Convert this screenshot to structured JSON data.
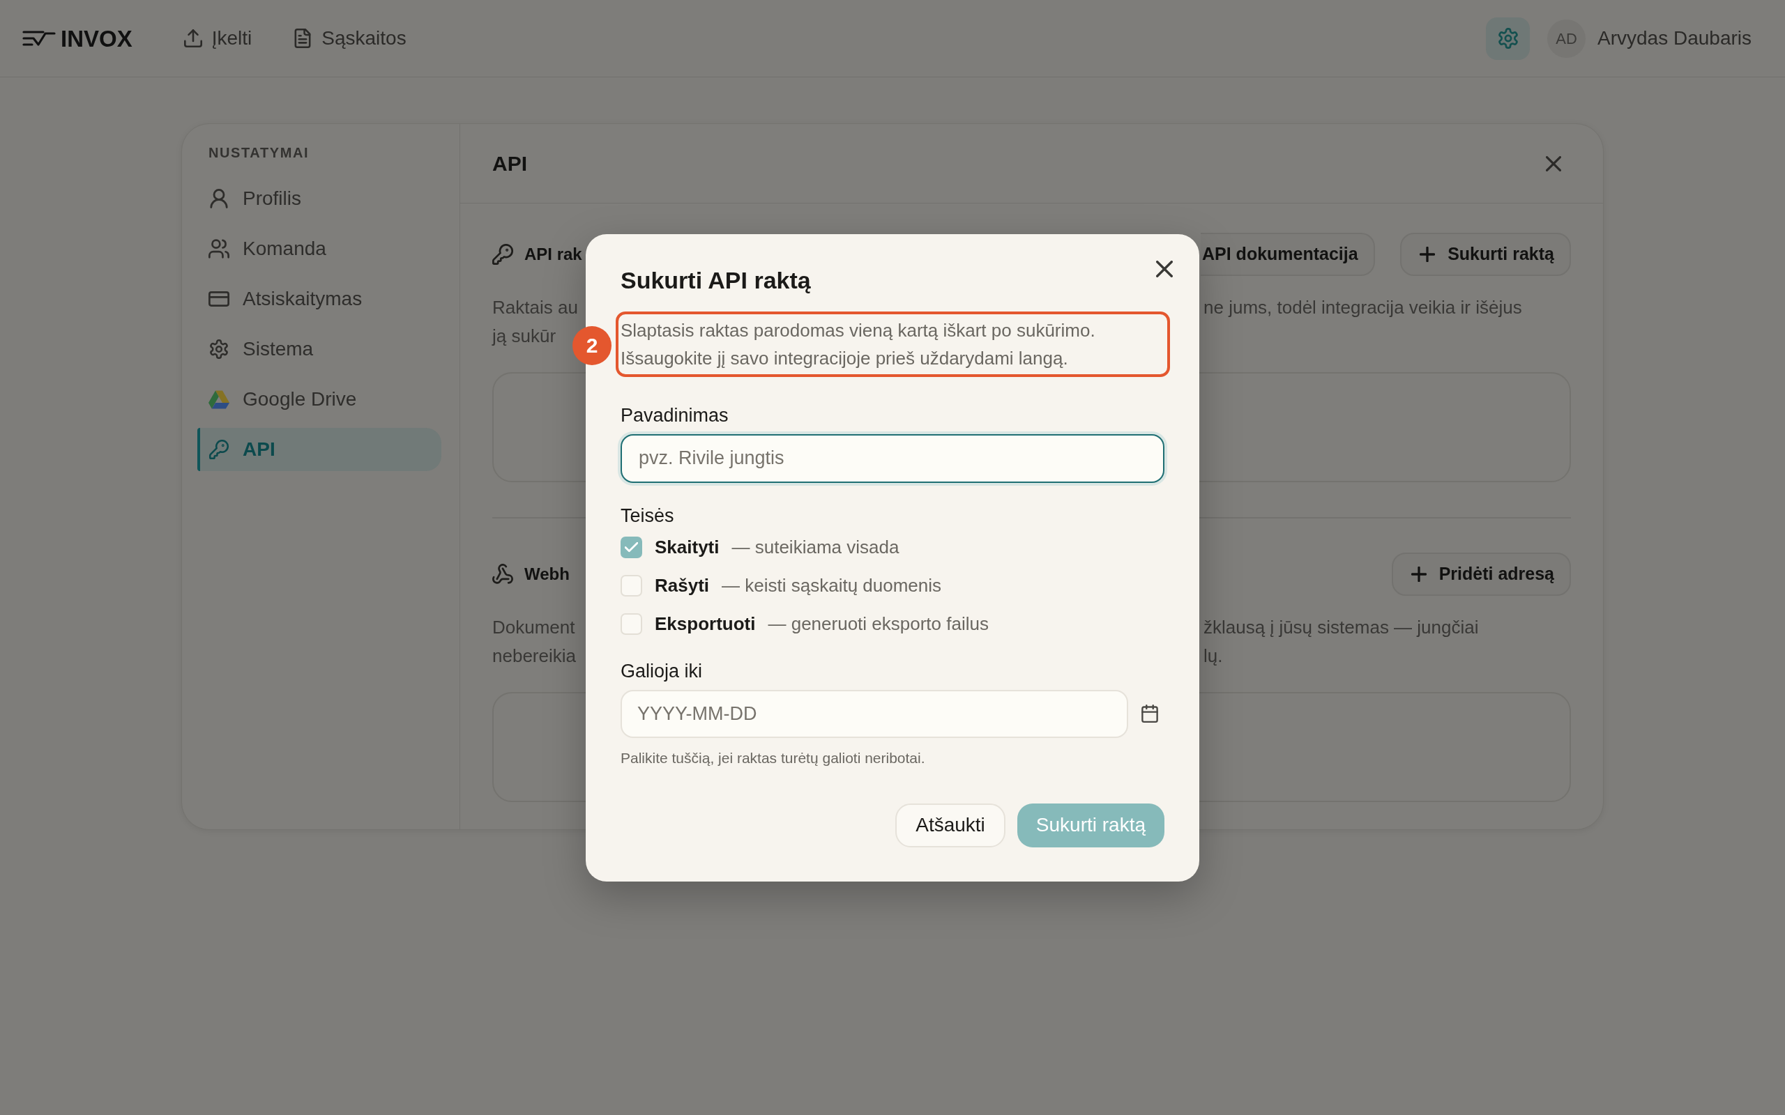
{
  "top_bar": {
    "logo": "INVOX",
    "nav": [
      {
        "label": "Įkelti"
      },
      {
        "label": "Sąskaitos"
      }
    ],
    "settings_button": {
      "selected": true
    },
    "user": {
      "initials": "AD",
      "name": "Arvydas Daubaris"
    }
  },
  "settings": {
    "heading": "NUSTATYMAI",
    "items": [
      {
        "label": "Profilis",
        "selected": false
      },
      {
        "label": "Komanda",
        "selected": false
      },
      {
        "label": "Atsiskaitymas",
        "selected": false
      },
      {
        "label": "Sistema",
        "selected": false
      },
      {
        "label": "Google Drive",
        "selected": false
      },
      {
        "label": "API",
        "selected": true
      }
    ]
  },
  "panel": {
    "title": "API",
    "sections": [
      {
        "title": "API rak",
        "buttons": [
          {
            "label": "API dokumentacija",
            "kind": "plain"
          },
          {
            "label": "Sukurti raktą",
            "kind": "add"
          }
        ],
        "text_left": [
          "Raktais au",
          "ją sukūr"
        ],
        "text_right": [
          "ne jums, todėl integracija veikia ir išėjus"
        ]
      },
      {
        "title": "Webh",
        "buttons": [
          {
            "label": "Pridėti adresą",
            "kind": "add"
          }
        ],
        "text_left": [
          "Dokument",
          "nebereikia"
        ],
        "text_right": [
          "žklausą į jūsų sistemas — jungčiai",
          "lų."
        ]
      }
    ]
  },
  "dialog": {
    "title": "Sukurti API raktą",
    "notice": "Slaptasis raktas parodomas vieną kartą iškart po sukūrimo. Išsaugokite jį savo integracijoje prieš uždarydami langą.",
    "annotation": {
      "number": "2"
    },
    "name_field": {
      "label": "Pavadinimas",
      "placeholder": "pvz. Rivile jungtis",
      "focused": true
    },
    "permissions": {
      "label": "Teisės",
      "options": [
        {
          "label": "Skaityti",
          "description": "— suteikiama visada",
          "checked": true
        },
        {
          "label": "Rašyti",
          "description": "— keisti sąskaitų duomenis",
          "checked": false
        },
        {
          "label": "Eksportuoti",
          "description": "— generuoti eksporto failus",
          "checked": false
        }
      ]
    },
    "expiry_field": {
      "label": "Galioja iki",
      "placeholder": "YYYY-MM-DD",
      "hint": "Palikite tuščią, jei raktas turėtų galioti neribotai."
    },
    "buttons": [
      {
        "label": "Atšaukti",
        "kind": "secondary",
        "disabled": false
      },
      {
        "label": "Sukurti raktą",
        "kind": "primary",
        "disabled": true
      }
    ]
  }
}
